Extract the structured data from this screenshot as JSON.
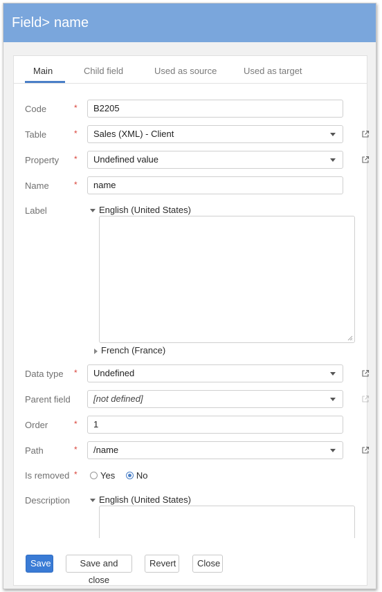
{
  "title": {
    "entity": "Field",
    "name": "name"
  },
  "tabs": [
    "Main",
    "Child field",
    "Used as source",
    "Used as target"
  ],
  "fields": {
    "code": {
      "label": "Code",
      "value": "B2205"
    },
    "table": {
      "label": "Table",
      "value": "Sales (XML) - Client"
    },
    "property": {
      "label": "Property",
      "value": "Undefined value"
    },
    "name": {
      "label": "Name",
      "value": "name"
    },
    "label": {
      "label": "Label",
      "lang_expanded": "English (United States)",
      "lang_collapsed": "French (France)",
      "value": ""
    },
    "data_type": {
      "label": "Data type",
      "value": "Undefined"
    },
    "parent_field": {
      "label": "Parent field",
      "value": "[not defined]"
    },
    "order": {
      "label": "Order",
      "value": "1"
    },
    "path": {
      "label": "Path",
      "value": "/name"
    },
    "is_removed": {
      "label": "Is removed",
      "options": [
        "Yes",
        "No"
      ],
      "selected": "No"
    },
    "description": {
      "label": "Description",
      "lang_expanded": "English (United States)",
      "value": ""
    }
  },
  "required_mark": "*",
  "buttons": {
    "save": "Save",
    "save_close": "Save and close",
    "revert": "Revert",
    "close": "Close"
  },
  "colors": {
    "header": "#7aa6dc",
    "accent": "#3a7bd5",
    "required": "#d9453c"
  },
  "icons": {
    "external_link": "external-link-icon"
  }
}
